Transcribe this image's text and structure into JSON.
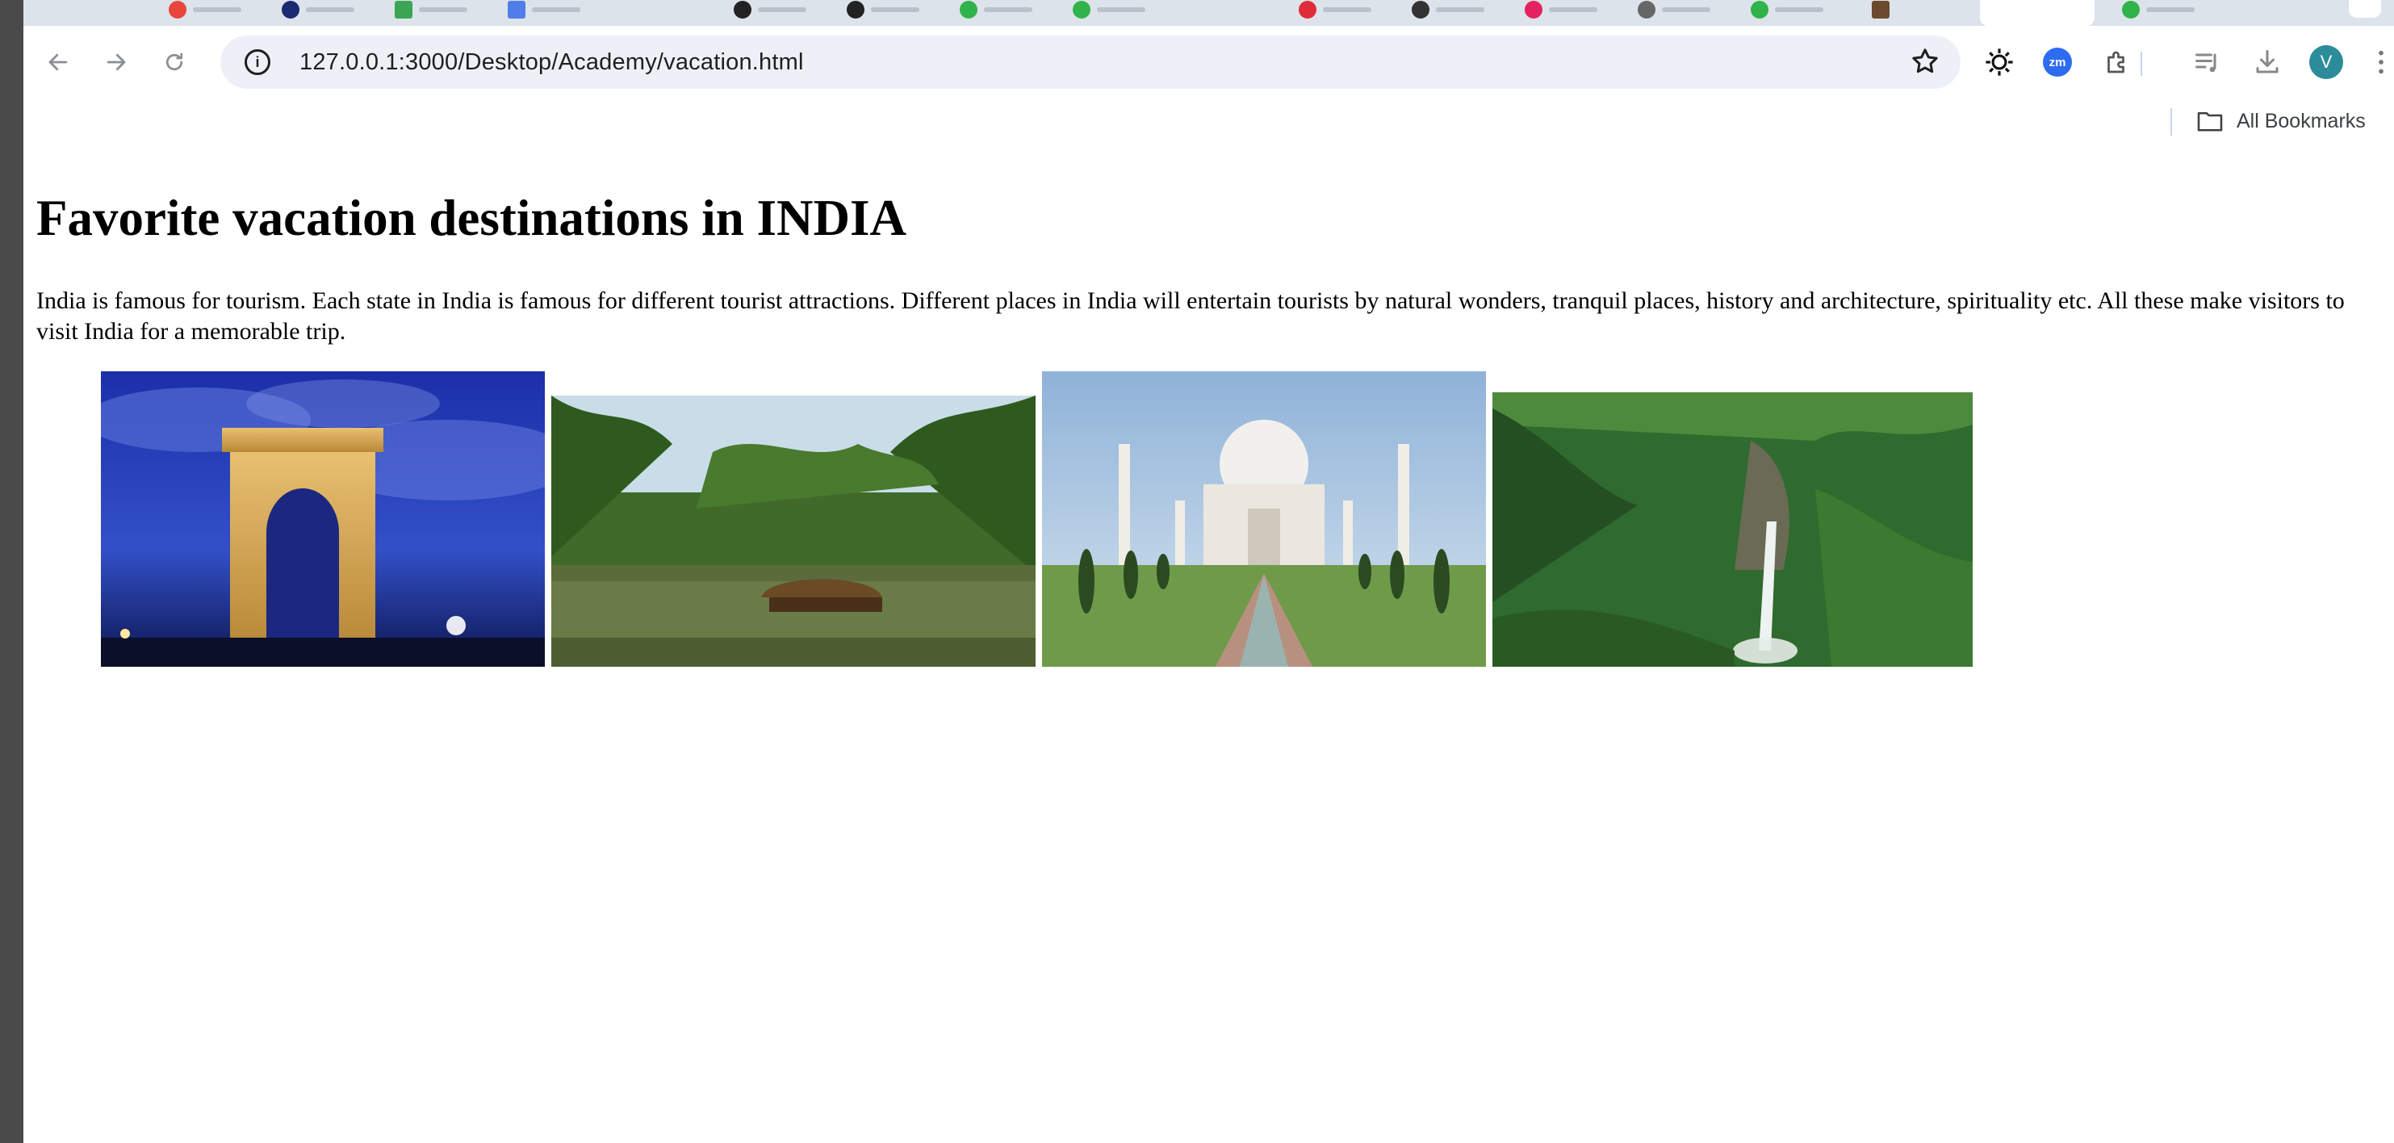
{
  "browser": {
    "url": "127.0.0.1:3000/Desktop/Academy/vacation.html",
    "profile_initial": "V",
    "zoom_extension_label": "zm",
    "bookmarks_label": "All Bookmarks",
    "icons": [
      "back-icon",
      "forward-icon",
      "reload-icon",
      "site-info-icon",
      "star-icon",
      "extension-sun-icon",
      "zoom-extension-icon",
      "extensions-puzzle-icon",
      "reading-list-icon",
      "download-icon",
      "profile-avatar",
      "menu-kebab-icon",
      "folder-icon"
    ]
  },
  "page": {
    "title": "Favorite vacation destinations in INDIA",
    "intro": "India is famous for tourism. Each state in India is famous for different tourist attractions. Different places in India will entertain tourists by natural wonders, tranquil places, history and architecture, spirituality etc. All these make visitors to visit India for a memorable trip.",
    "photos": [
      {
        "subject": "India Gate at night"
      },
      {
        "subject": "Kerala backwaters houseboat"
      },
      {
        "subject": "Taj Mahal"
      },
      {
        "subject": "Waterfall in green gorge"
      }
    ]
  },
  "colors": {
    "tabstrip": "#dde3ea",
    "omnibox": "#edf1f7",
    "avatar": "#2c8c99",
    "zoom_ext": "#2d6cf0"
  }
}
